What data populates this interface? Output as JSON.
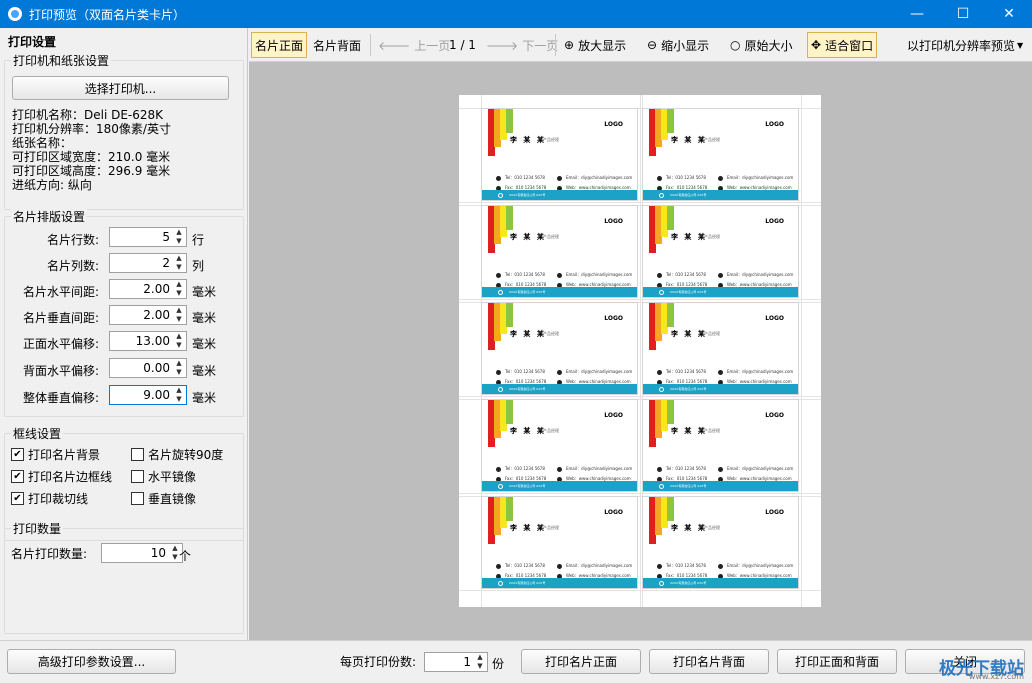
{
  "window": {
    "title": "打印预览（双面名片类卡片）",
    "minimize": "—",
    "maximize": "☐",
    "close": "✕"
  },
  "left": {
    "header": "打印设置",
    "printer_group": {
      "title": "打印机和纸张设置",
      "select_button": "选择打印机...",
      "lines": [
        "打印机名称：Deli DE-628K",
        "打印机分辨率：180像素/英寸",
        "纸张名称：",
        "可打印区域宽度：210.0 毫米",
        "可打印区域高度：296.9 毫米",
        "进纸方向: 纵向"
      ]
    },
    "layout_group": {
      "title": "名片排版设置",
      "fields": [
        {
          "label": "名片行数:",
          "value": "5",
          "unit": "行"
        },
        {
          "label": "名片列数:",
          "value": "2",
          "unit": "列"
        },
        {
          "label": "名片水平间距:",
          "value": "2.00",
          "unit": "毫米"
        },
        {
          "label": "名片垂直间距:",
          "value": "2.00",
          "unit": "毫米"
        },
        {
          "label": "正面水平偏移:",
          "value": "13.00",
          "unit": "毫米"
        },
        {
          "label": "背面水平偏移:",
          "value": "0.00",
          "unit": "毫米"
        },
        {
          "label": "整体垂直偏移:",
          "value": "9.00",
          "unit": "毫米"
        }
      ]
    },
    "frame_group": {
      "title": "框线设置",
      "checks": [
        {
          "label": "打印名片背景",
          "checked": true
        },
        {
          "label": "名片旋转90度",
          "checked": false
        },
        {
          "label": "打印名片边框线",
          "checked": true
        },
        {
          "label": "水平镜像",
          "checked": false
        },
        {
          "label": "打印裁切线",
          "checked": true
        },
        {
          "label": "垂直镜像",
          "checked": false
        }
      ]
    },
    "count_group": {
      "title": "打印数量",
      "label": "名片打印数量:",
      "value": "10",
      "unit": "个"
    }
  },
  "toolbar": {
    "front": "名片正面",
    "back": "名片背面",
    "prev": "上一页",
    "page": "1 / 1",
    "next": "下一页",
    "zoom_in": "放大显示",
    "zoom_out": "缩小显示",
    "original": "原始大小",
    "fit": "适合窗口",
    "resolution": "以打印机分辨率预览"
  },
  "card": {
    "logo": "LOGO",
    "name": "李 某 某",
    "role": "产品经理",
    "tel": "Tel：010 1234 5678",
    "fax": "Fax：010 1234 5678",
    "email": "Email：diy@chinadiyimages.com",
    "web": "Web：www.chinadiyimages.com",
    "footer_text": "XXXX有限责任公司 XXX号"
  },
  "bottom": {
    "advanced": "高级打印参数设置...",
    "copies_label": "每页打印份数:",
    "copies_value": "1",
    "copies_unit": "份",
    "print_front": "打印名片正面",
    "print_back": "打印名片背面",
    "print_both": "打印正面和背面",
    "close": "关闭"
  },
  "watermark": {
    "text": "极光下载站",
    "sub": "www.xz7.com"
  }
}
